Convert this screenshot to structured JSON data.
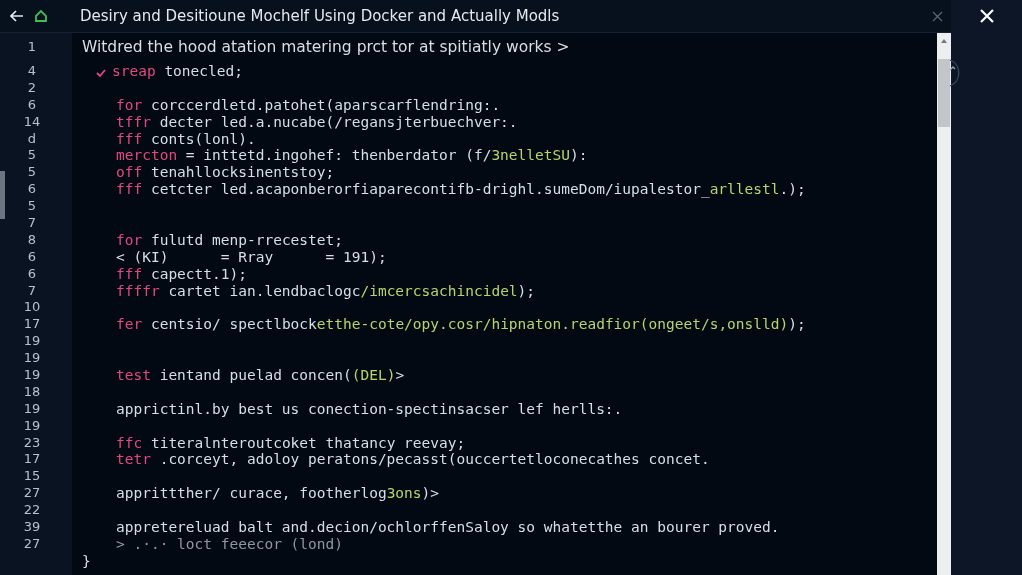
{
  "window": {
    "title": "Desiry and Desitioune Mochelf Using Docker and Actually Modls"
  },
  "editor": {
    "lines": [
      {
        "number": "1",
        "kind": "comment",
        "segments": [
          {
            "kind": "plain",
            "text": "Witdred the hood atation matering prct tor at spitiatly works >"
          }
        ]
      },
      {
        "number": "4",
        "kind": "statement",
        "checked": true,
        "segments": [
          {
            "kind": "keyword",
            "text": "sreap"
          },
          {
            "kind": "plain",
            "text": " tonecled;"
          }
        ]
      },
      {
        "number": "2",
        "kind": "blank"
      },
      {
        "number": "6",
        "kind": "code",
        "segments": [
          {
            "kind": "keyword",
            "text": "for"
          },
          {
            "kind": "plain",
            "text": " corccerdletd.patohet(aparscarflendring:."
          }
        ]
      },
      {
        "number": "14",
        "kind": "code",
        "segments": [
          {
            "kind": "keyword",
            "text": "tffr"
          },
          {
            "kind": "plain",
            "text": " decter led.a.nucabe(/regansjterbuechver:."
          }
        ]
      },
      {
        "number": "d",
        "kind": "code",
        "segments": [
          {
            "kind": "keyword",
            "text": "fff"
          },
          {
            "kind": "plain",
            "text": " conts(lonl)."
          }
        ]
      },
      {
        "number": "5",
        "kind": "code",
        "segments": [
          {
            "kind": "keyword",
            "text": "mercton"
          },
          {
            "kind": "plain",
            "text": " = inttetd.ingohef: thenberdator (f/"
          },
          {
            "kind": "string",
            "text": "3nelletSU"
          },
          {
            "kind": "plain",
            "text": "):"
          }
        ]
      },
      {
        "number": "5",
        "kind": "code",
        "segments": [
          {
            "kind": "keyword",
            "text": "off"
          },
          {
            "kind": "plain",
            "text": " tenahllocksinentstoy;"
          }
        ]
      },
      {
        "number": "6",
        "kind": "code",
        "segments": [
          {
            "kind": "keyword",
            "text": "fff"
          },
          {
            "kind": "plain",
            "text": " cetcter led.acaponberorfiaparecontifb-drighl.sumeDom/iupalestor_"
          },
          {
            "kind": "string",
            "text": "arllestl"
          },
          {
            "kind": "plain",
            "text": ".);"
          }
        ]
      },
      {
        "number": "5",
        "kind": "blank"
      },
      {
        "number": "7",
        "kind": "blank"
      },
      {
        "number": "8",
        "kind": "code",
        "segments": [
          {
            "kind": "keyword",
            "text": "for"
          },
          {
            "kind": "plain",
            "text": " fulutd menp-rrecestet;"
          }
        ]
      },
      {
        "number": "6",
        "kind": "code",
        "segments": [
          {
            "kind": "plain",
            "text": "< (KI)      = Rray      = 191);"
          }
        ]
      },
      {
        "number": "6",
        "kind": "code",
        "segments": [
          {
            "kind": "keyword",
            "text": "fff"
          },
          {
            "kind": "plain",
            "text": " capectt.1);"
          }
        ]
      },
      {
        "number": "7",
        "kind": "code",
        "segments": [
          {
            "kind": "keyword",
            "text": "ffffr"
          },
          {
            "kind": "plain",
            "text": " cartet ian.lendbaclogc"
          },
          {
            "kind": "string",
            "text": "/imcercsachincidel"
          },
          {
            "kind": "plain",
            "text": ");"
          }
        ]
      },
      {
        "number": "10",
        "kind": "blank"
      },
      {
        "number": "17",
        "kind": "code",
        "segments": [
          {
            "kind": "keyword",
            "text": "fer"
          },
          {
            "kind": "plain",
            "text": " centsio/ spectlbock"
          },
          {
            "kind": "string",
            "text": "etthe-cote/opy.cosr/hipnaton.readfior(ongeet/s,onslld)"
          },
          {
            "kind": "plain",
            "text": ");"
          }
        ]
      },
      {
        "number": "19",
        "kind": "blank"
      },
      {
        "number": "19",
        "kind": "blank"
      },
      {
        "number": "19",
        "kind": "code",
        "segments": [
          {
            "kind": "keyword",
            "text": "test"
          },
          {
            "kind": "plain",
            "text": " ientand puelad concen("
          },
          {
            "kind": "string",
            "text": "(DEL)"
          },
          {
            "kind": "plain",
            "text": ">"
          }
        ]
      },
      {
        "number": "18",
        "kind": "blank"
      },
      {
        "number": "19",
        "kind": "code",
        "segments": [
          {
            "kind": "plain",
            "text": "apprictinl.by best us conection-spectinsacser lef herlls:."
          }
        ]
      },
      {
        "number": "19",
        "kind": "blank"
      },
      {
        "number": "23",
        "kind": "code",
        "segments": [
          {
            "kind": "keyword",
            "text": "ffc"
          },
          {
            "kind": "plain",
            "text": " titeralnteroutcoket thatancy reevay;"
          }
        ]
      },
      {
        "number": "17",
        "kind": "code",
        "segments": [
          {
            "kind": "keyword",
            "text": "tetr"
          },
          {
            "kind": "plain",
            "text": " .corceyt, adoloy peratons/pecasst(ouccertetloconecathes concet."
          }
        ]
      },
      {
        "number": "15",
        "kind": "blank"
      },
      {
        "number": "27",
        "kind": "code",
        "segments": [
          {
            "kind": "plain",
            "text": "apprittther/ curace, footherlog"
          },
          {
            "kind": "string",
            "text": "3ons"
          },
          {
            "kind": "plain",
            "text": ")>"
          }
        ]
      },
      {
        "number": "22",
        "kind": "blank"
      },
      {
        "number": "39",
        "kind": "code",
        "segments": [
          {
            "kind": "plain",
            "text": "appretereluad balt and.decion/ochlorffenSaloy so whatetthe an bourer proved."
          }
        ]
      },
      {
        "number": "27",
        "kind": "code",
        "segments": [
          {
            "kind": "dim",
            "text": "> .·.· loct feeecor (lond)"
          }
        ]
      },
      {
        "kind": "close",
        "segments": [
          {
            "kind": "plain",
            "text": "}"
          }
        ]
      }
    ]
  }
}
